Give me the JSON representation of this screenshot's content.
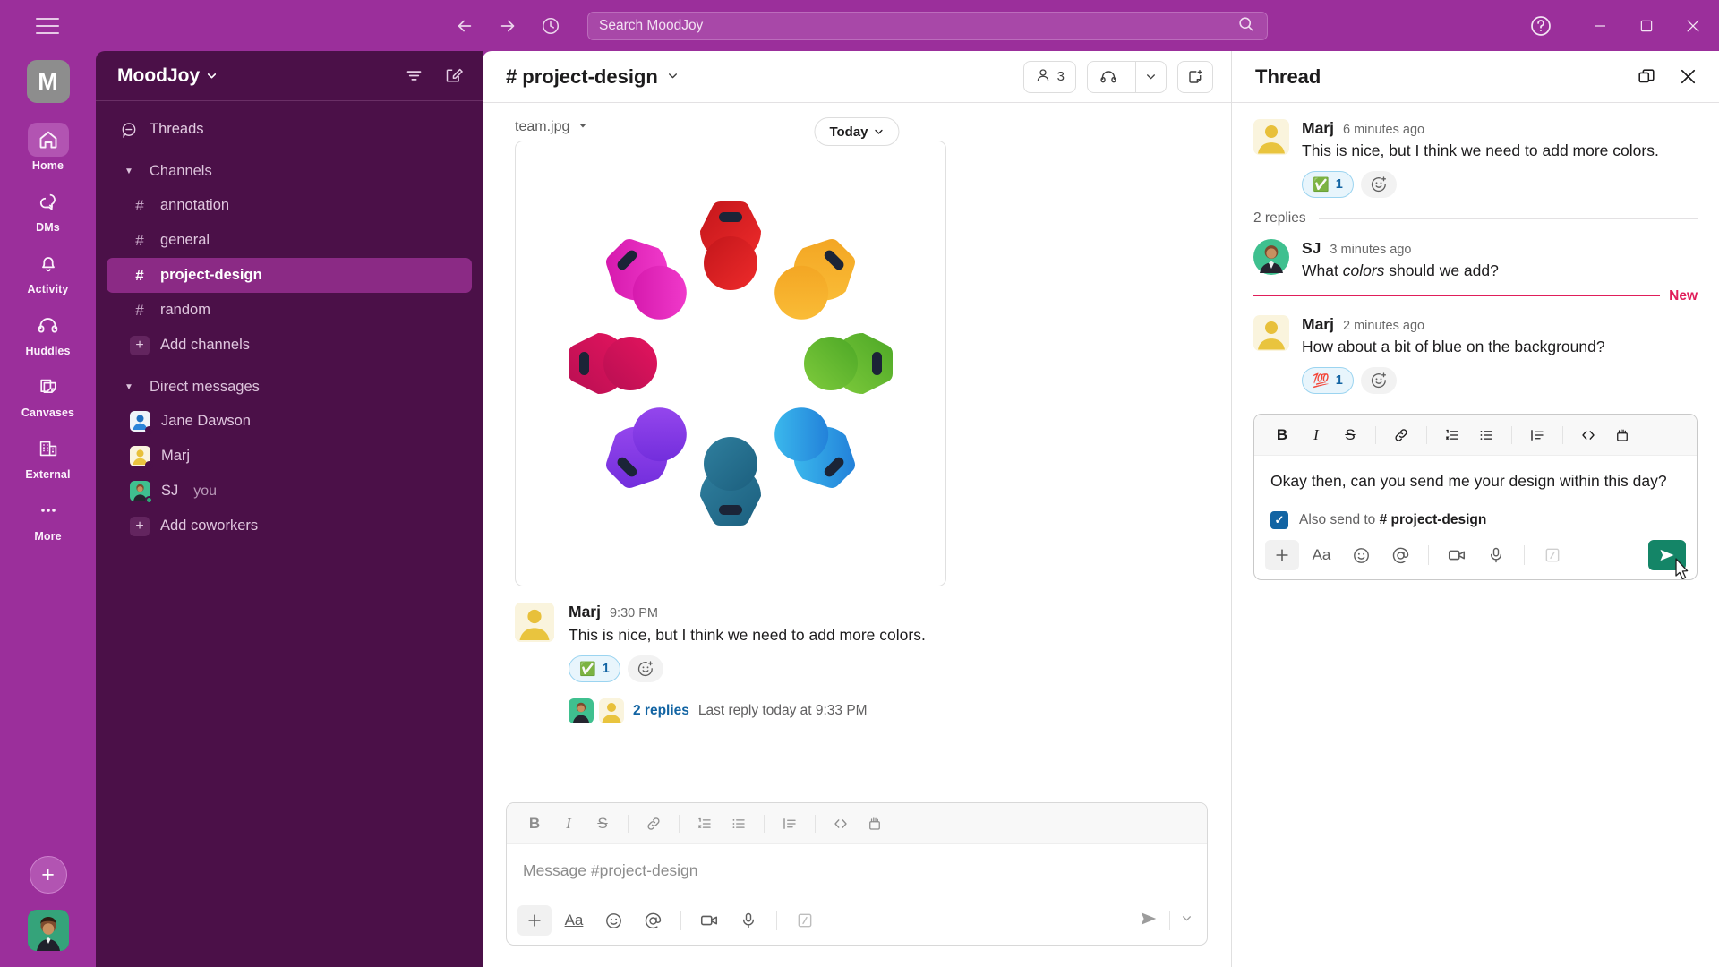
{
  "titlebar": {
    "menu_icon": "hamburger-icon",
    "back_icon": "arrow-left-icon",
    "forward_icon": "arrow-right-icon",
    "history_icon": "clock-icon",
    "search_placeholder": "Search MoodJoy",
    "search_icon": "search-icon",
    "help_icon": "help-circle-icon",
    "minimize_icon": "minimize-icon",
    "maximize_icon": "maximize-icon",
    "close_icon": "close-icon"
  },
  "rail": {
    "workspace_initial": "M",
    "items": [
      {
        "label": "Home",
        "icon": "home-icon",
        "active": true
      },
      {
        "label": "DMs",
        "icon": "dms-icon",
        "active": false
      },
      {
        "label": "Activity",
        "icon": "bell-icon",
        "active": false
      },
      {
        "label": "Huddles",
        "icon": "headphones-icon",
        "active": false
      },
      {
        "label": "Canvases",
        "icon": "canvas-icon",
        "active": false
      },
      {
        "label": "External",
        "icon": "building-icon",
        "active": false
      },
      {
        "label": "More",
        "icon": "ellipsis-icon",
        "active": false
      }
    ],
    "new_button": "+"
  },
  "sidebar": {
    "workspace_name": "MoodJoy",
    "workspace_caret": "chevron-down-icon",
    "filter_icon": "filter-icon",
    "compose_icon": "compose-icon",
    "threads_label": "Threads",
    "channels_section": "Channels",
    "channels": [
      {
        "name": "annotation",
        "selected": false
      },
      {
        "name": "general",
        "selected": false
      },
      {
        "name": "project-design",
        "selected": true
      },
      {
        "name": "random",
        "selected": false
      }
    ],
    "add_channels": "Add channels",
    "dm_section": "Direct messages",
    "dms": [
      {
        "name": "Jane Dawson",
        "you": "",
        "online": false,
        "avatar": "blue"
      },
      {
        "name": "Marj",
        "you": "",
        "online": false,
        "avatar": "yellow"
      },
      {
        "name": "SJ",
        "you": "you",
        "online": true,
        "avatar": "green"
      }
    ],
    "add_coworkers": "Add coworkers"
  },
  "channel": {
    "name": "project-design",
    "hash": "#",
    "caret_icon": "chevron-down-icon",
    "members_count": "3",
    "members_icon": "person-icon",
    "huddle_icon": "headphones-icon",
    "huddle_caret_icon": "chevron-down-icon",
    "canvas_icon": "add-canvas-icon"
  },
  "messages": {
    "date_divider": "Today",
    "date_divider_caret": "chevron-down-icon",
    "attachment_name": "team.jpg",
    "attachment_caret": "chevron-down-icon",
    "attachment_alt": "team-circle-illustration",
    "main_message": {
      "author": "Marj",
      "time": "9:30 PM",
      "text": "This is nice, but I think we need to add more colors.",
      "reaction_emoji": "✅",
      "reaction_count": "1",
      "add_reaction_icon": "add-reaction-icon",
      "replies_link": "2 replies",
      "replies_meta": "Last reply today at 9:33 PM"
    }
  },
  "composer": {
    "placeholder": "Message #project-design",
    "format_buttons": [
      {
        "name": "bold",
        "glyph": "B"
      },
      {
        "name": "italic",
        "glyph": "I"
      },
      {
        "name": "strikethrough",
        "glyph": "S"
      },
      {
        "name": "link",
        "glyph": "link-icon"
      },
      {
        "name": "ordered-list",
        "glyph": "ordered-list-icon"
      },
      {
        "name": "bulleted-list",
        "glyph": "bulleted-list-icon"
      },
      {
        "name": "blockquote",
        "glyph": "blockquote-icon"
      },
      {
        "name": "code",
        "glyph": "code-icon"
      },
      {
        "name": "code-block",
        "glyph": "code-block-icon"
      }
    ],
    "action_buttons": [
      {
        "name": "attach",
        "glyph": "plus-icon"
      },
      {
        "name": "formatting",
        "glyph": "Aa"
      },
      {
        "name": "emoji",
        "glyph": "emoji-icon"
      },
      {
        "name": "mention",
        "glyph": "at-icon"
      },
      {
        "name": "video",
        "glyph": "video-icon"
      },
      {
        "name": "audio",
        "glyph": "microphone-icon"
      },
      {
        "name": "shortcuts",
        "glyph": "slash-icon"
      }
    ],
    "send_icon": "send-icon",
    "send_caret_icon": "chevron-down-icon"
  },
  "thread": {
    "title": "Thread",
    "open_icon": "open-in-new-icon",
    "close_icon": "close-icon",
    "root": {
      "author": "Marj",
      "time": "6 minutes ago",
      "text": "This is nice, but I think we need to add more colors.",
      "reaction_emoji": "✅",
      "reaction_count": "1",
      "add_reaction_icon": "add-reaction-icon"
    },
    "replies_label": "2 replies",
    "new_label": "New",
    "replies": [
      {
        "author": "SJ",
        "time": "3 minutes ago",
        "text_before": "What ",
        "text_italic": "colors",
        "text_after": " should we add?",
        "avatar": "green",
        "reaction_emoji": "",
        "reaction_count": ""
      },
      {
        "author": "Marj",
        "time": "2 minutes ago",
        "text_before": "How about a bit of blue on the background?",
        "text_italic": "",
        "text_after": "",
        "avatar": "yellow",
        "reaction_emoji": "💯",
        "reaction_count": "1"
      }
    ],
    "composer": {
      "value": "Okay then, can you send me your design within this day?",
      "also_send_label": "Also send to",
      "also_send_channel": "# project-design",
      "checkbox_checked": true,
      "send_icon": "send-icon"
    }
  },
  "colors": {
    "brand_purple": "#9B2F9B",
    "sidebar_purple": "#4B1048",
    "selected_channel": "#8B2A85",
    "link_blue": "#1264A3",
    "new_red": "#E01E5A",
    "send_green": "#148567",
    "checkbox_blue": "#1264A3"
  }
}
